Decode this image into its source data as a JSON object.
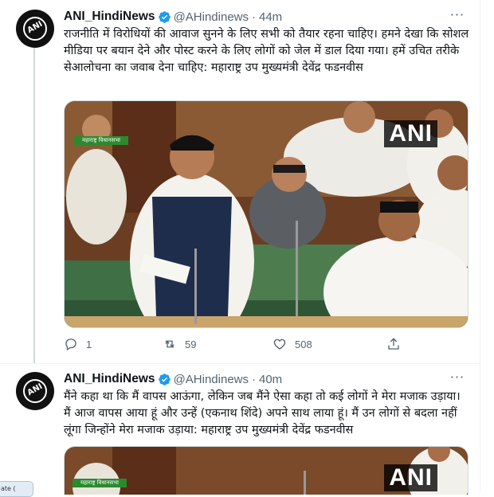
{
  "tweets": [
    {
      "display_name": "ANI_HindiNews",
      "handle": "@AHindinews",
      "separator": "·",
      "time": "44m",
      "more": "···",
      "text": "राजनीति में विरोधियों की आवाज सुनने के लिए सभी को तैयार रहना चाहिए। हमने देखा कि सोशल मीडिया पर बयान देने और पोस्ट करने के लिए लोगों को जेल में डाल दिया गया। हमें उचित तरीके सेआलोचना का जवाब देना चाहिए: महाराष्ट्र उप मुख्यमंत्री देवेंद्र फडनवीस",
      "media_watermark": "ANI",
      "media_badge": "महाराष्ट्र विधानसभा",
      "replies": "1",
      "retweets": "59",
      "likes": "508"
    },
    {
      "display_name": "ANI_HindiNews",
      "handle": "@AHindinews",
      "separator": "·",
      "time": "40m",
      "more": "···",
      "text": "मैंने कहा था कि मैं वापस आऊंगा, लेकिन जब मैंने ऐसा कहा तो कई लोगों ने मेरा मजाक उड़ाया। मैं आज वापस आया हूं और उन्हें (एकनाथ शिंदे) अपने साथ लाया हूं। मैं उन लोगों से बदला नहीं लूंगा जिन्होंने मेरा मजाक उड़ाया: महाराष्ट्र उप मुख्यमंत्री देवेंद्र फडनवीस",
      "media_watermark": "ANI",
      "media_badge": "महाराष्ट्र विधानसभा"
    }
  ],
  "avatar_text": "ANI",
  "side_pill": "ate ("
}
